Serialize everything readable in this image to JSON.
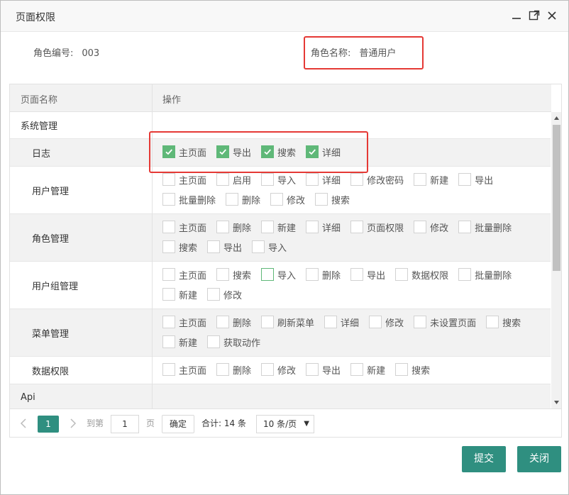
{
  "dialog": {
    "title": "页面权限"
  },
  "role": {
    "id_label": "角色编号:",
    "id_value": "003",
    "name_label": "角色名称:",
    "name_value": "普通用户"
  },
  "table": {
    "headers": [
      "页面名称",
      "操作"
    ],
    "rows": [
      {
        "name": "系统管理",
        "level": 0,
        "ops": []
      },
      {
        "name": "日志",
        "level": 1,
        "ops": [
          {
            "label": "主页面",
            "checked": true
          },
          {
            "label": "导出",
            "checked": true
          },
          {
            "label": "搜索",
            "checked": true
          },
          {
            "label": "详细",
            "checked": true
          }
        ]
      },
      {
        "name": "用户管理",
        "level": 1,
        "ops": [
          {
            "label": "主页面",
            "checked": false
          },
          {
            "label": "启用",
            "checked": false
          },
          {
            "label": "导入",
            "checked": false
          },
          {
            "label": "详细",
            "checked": false
          },
          {
            "label": "修改密码",
            "checked": false
          },
          {
            "label": "新建",
            "checked": false
          },
          {
            "label": "导出",
            "checked": false
          },
          {
            "label": "批量删除",
            "checked": false
          },
          {
            "label": "删除",
            "checked": false
          },
          {
            "label": "修改",
            "checked": false
          },
          {
            "label": "搜索",
            "checked": false
          }
        ]
      },
      {
        "name": "角色管理",
        "level": 1,
        "ops": [
          {
            "label": "主页面",
            "checked": false
          },
          {
            "label": "删除",
            "checked": false
          },
          {
            "label": "新建",
            "checked": false
          },
          {
            "label": "详细",
            "checked": false
          },
          {
            "label": "页面权限",
            "checked": false
          },
          {
            "label": "修改",
            "checked": false
          },
          {
            "label": "批量删除",
            "checked": false
          },
          {
            "label": "搜索",
            "checked": false
          },
          {
            "label": "导出",
            "checked": false
          },
          {
            "label": "导入",
            "checked": false
          }
        ]
      },
      {
        "name": "用户组管理",
        "level": 1,
        "ops": [
          {
            "label": "主页面",
            "checked": false
          },
          {
            "label": "搜索",
            "checked": false
          },
          {
            "label": "导入",
            "checked": false,
            "hover": true
          },
          {
            "label": "删除",
            "checked": false
          },
          {
            "label": "导出",
            "checked": false
          },
          {
            "label": "数据权限",
            "checked": false
          },
          {
            "label": "批量删除",
            "checked": false
          },
          {
            "label": "新建",
            "checked": false
          },
          {
            "label": "修改",
            "checked": false
          }
        ]
      },
      {
        "name": "菜单管理",
        "level": 1,
        "ops": [
          {
            "label": "主页面",
            "checked": false
          },
          {
            "label": "删除",
            "checked": false
          },
          {
            "label": "刷新菜单",
            "checked": false
          },
          {
            "label": "详细",
            "checked": false
          },
          {
            "label": "修改",
            "checked": false
          },
          {
            "label": "未设置页面",
            "checked": false
          },
          {
            "label": "搜索",
            "checked": false
          },
          {
            "label": "新建",
            "checked": false
          },
          {
            "label": "获取动作",
            "checked": false
          }
        ]
      },
      {
        "name": "数据权限",
        "level": 1,
        "ops": [
          {
            "label": "主页面",
            "checked": false
          },
          {
            "label": "删除",
            "checked": false
          },
          {
            "label": "修改",
            "checked": false
          },
          {
            "label": "导出",
            "checked": false
          },
          {
            "label": "新建",
            "checked": false
          },
          {
            "label": "搜索",
            "checked": false
          }
        ]
      },
      {
        "name": "Api",
        "level": 0,
        "ops": []
      }
    ]
  },
  "pager": {
    "current_page": "1",
    "goto_prefix": "到第",
    "goto_value": "1",
    "goto_suffix": "页",
    "confirm_label": "确定",
    "total_text": "合计: 14 条",
    "page_size": "10 条/页"
  },
  "buttons": {
    "submit": "提交",
    "close": "关闭"
  },
  "colors": {
    "accent": "#2f8f80",
    "checkbox_on": "#5fb878",
    "highlight": "#e53935"
  }
}
